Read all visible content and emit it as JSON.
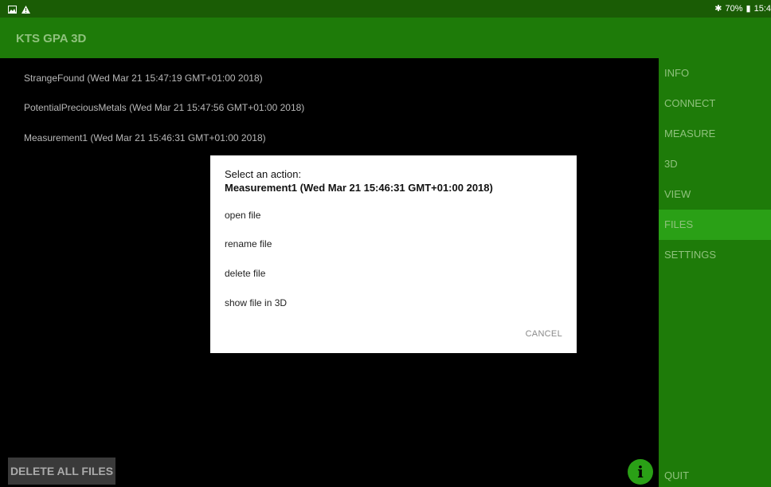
{
  "status_bar": {
    "right_text": "70%",
    "time": "15:4",
    "icons": [
      "image-icon",
      "warning-icon",
      "bluetooth-icon",
      "battery-icon"
    ]
  },
  "app": {
    "title": "KTS GPA 3D"
  },
  "files": [
    {
      "label": "StrangeFound (Wed Mar 21 15:47:19 GMT+01:00 2018)"
    },
    {
      "label": "PotentialPreciousMetals (Wed Mar 21 15:47:56 GMT+01:00 2018)"
    },
    {
      "label": "Measurement1 (Wed Mar 21 15:46:31 GMT+01:00 2018)"
    }
  ],
  "sidebar": {
    "items": [
      {
        "label": "INFO",
        "active": false
      },
      {
        "label": "CONNECT",
        "active": false
      },
      {
        "label": "MEASURE",
        "active": false
      },
      {
        "label": "3D",
        "active": false
      },
      {
        "label": "VIEW",
        "active": false
      },
      {
        "label": "FILES",
        "active": true
      },
      {
        "label": "SETTINGS",
        "active": false
      }
    ],
    "quit_label": "QUIT"
  },
  "dialog": {
    "title_line1": "Select an action:",
    "title_line2": "Measurement1 (Wed Mar 21 15:46:31 GMT+01:00 2018)",
    "options": [
      {
        "label": "open file"
      },
      {
        "label": "rename file"
      },
      {
        "label": "delete file"
      },
      {
        "label": "show file in 3D"
      }
    ],
    "cancel_label": "CANCEL"
  },
  "bottom": {
    "delete_all_label": "DELETE ALL FILES",
    "info_icon_glyph": "i"
  },
  "colors": {
    "statusbar": "#1a5c05",
    "appbar": "#1e7b09",
    "active_item": "#2aa016",
    "inactive_text": "#8fc27d"
  }
}
